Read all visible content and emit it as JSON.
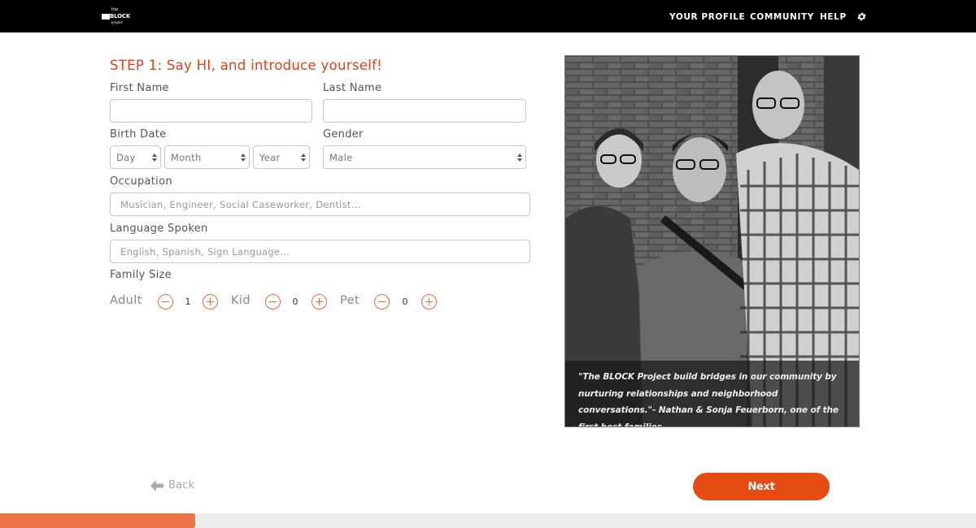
{
  "header": {
    "logo": {
      "the": "the",
      "block": "BLOCK",
      "project": "project"
    },
    "nav": [
      "YOUR PROFILE",
      "COMMUNITY",
      "HELP"
    ],
    "settings_icon": "gear-icon"
  },
  "form": {
    "step_title": "STEP 1: Say HI, and introduce yourself!",
    "first_name": {
      "label": "First Name",
      "value": "",
      "placeholder": ""
    },
    "last_name": {
      "label": "Last Name",
      "value": "",
      "placeholder": ""
    },
    "birth_date": {
      "label": "Birth Date",
      "day": "Day",
      "month": "Month",
      "year": "Year"
    },
    "gender": {
      "label": "Gender",
      "value": "Male"
    },
    "occupation": {
      "label": "Occupation",
      "placeholder": "Musician, Engineer, Social Caseworker, Dentist..."
    },
    "language": {
      "label": "Language Spoken",
      "placeholder": "English, Spanish, Sign Language..."
    },
    "family_size": {
      "label": "Family Size",
      "adult": {
        "label": "Adult",
        "count": "1"
      },
      "kid": {
        "label": "Kid",
        "count": "0"
      },
      "pet": {
        "label": "Pet",
        "count": "0"
      }
    }
  },
  "photo": {
    "caption": "\"The BLOCK Project build bridges in our community by nurturing relationships and neighborhood conversations.\"- Nathan & Sonja Feuerborn, one of the first host families"
  },
  "footer": {
    "back_label": "Back",
    "next_label": "Next",
    "progress": 0.2
  },
  "colors": {
    "accent": "#e44c13",
    "title": "#e2401b",
    "stepper": "#ee6a3d",
    "progress_fill": "#ec7345"
  }
}
